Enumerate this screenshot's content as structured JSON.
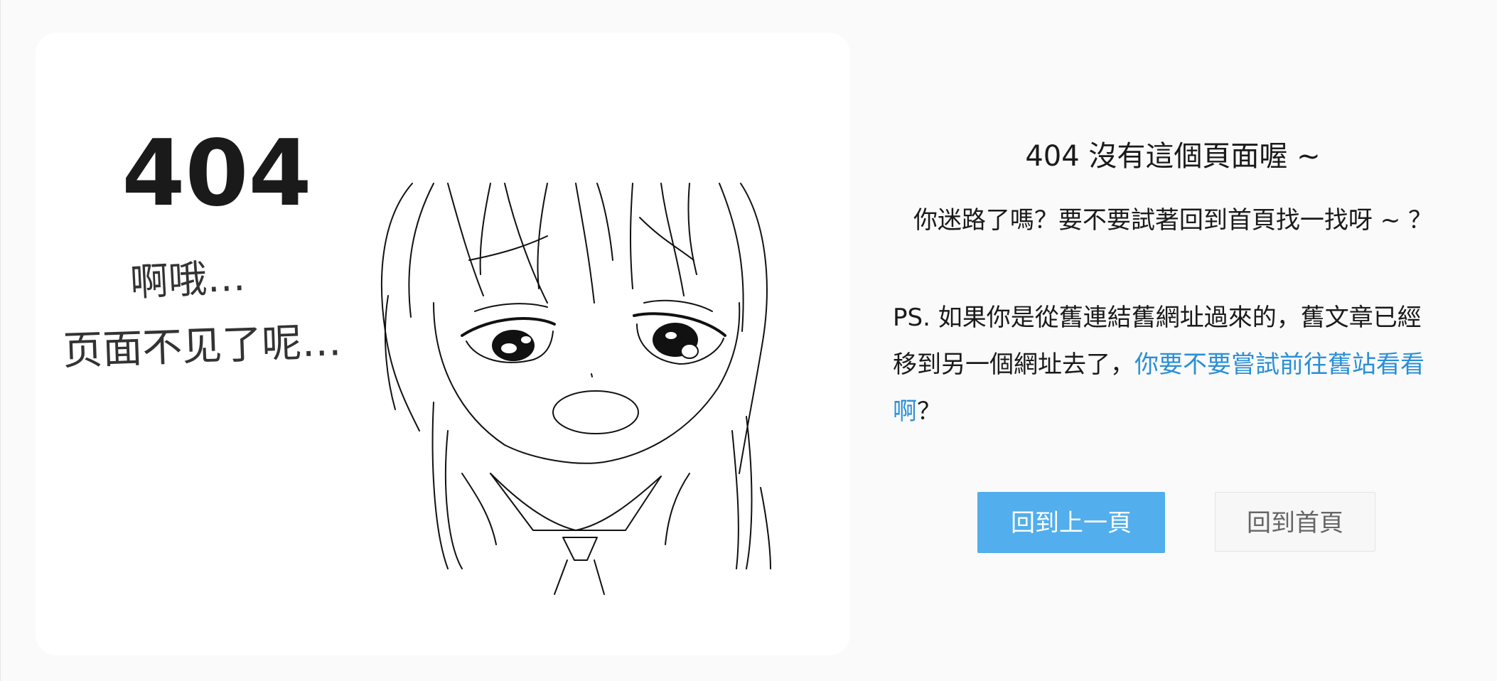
{
  "illustration": {
    "big_number": "404",
    "handwritten_line1": "啊哦…",
    "handwritten_line2": "页面不见了呢…"
  },
  "message": {
    "title": "404 沒有這個頁面喔 ~",
    "subtitle": "你迷路了嗎？要不要試著回到首頁找一找呀 ~ ？",
    "ps_line1": "PS. 如果你是從舊連結舊網址過來的，舊文章已經",
    "ps_line2_prefix": "移到另一個網址去了，",
    "ps_link_part1": "你要不要嘗試前往舊站看看",
    "ps_link_part2": "啊",
    "ps_suffix": "？"
  },
  "buttons": {
    "back_label": "回到上一頁",
    "home_label": "回到首頁"
  },
  "colors": {
    "page_background": "#fafafa",
    "card_background": "#ffffff",
    "link": "#2a8fd6",
    "primary_button": "#52aeec",
    "secondary_button": "#f7f7f7"
  }
}
